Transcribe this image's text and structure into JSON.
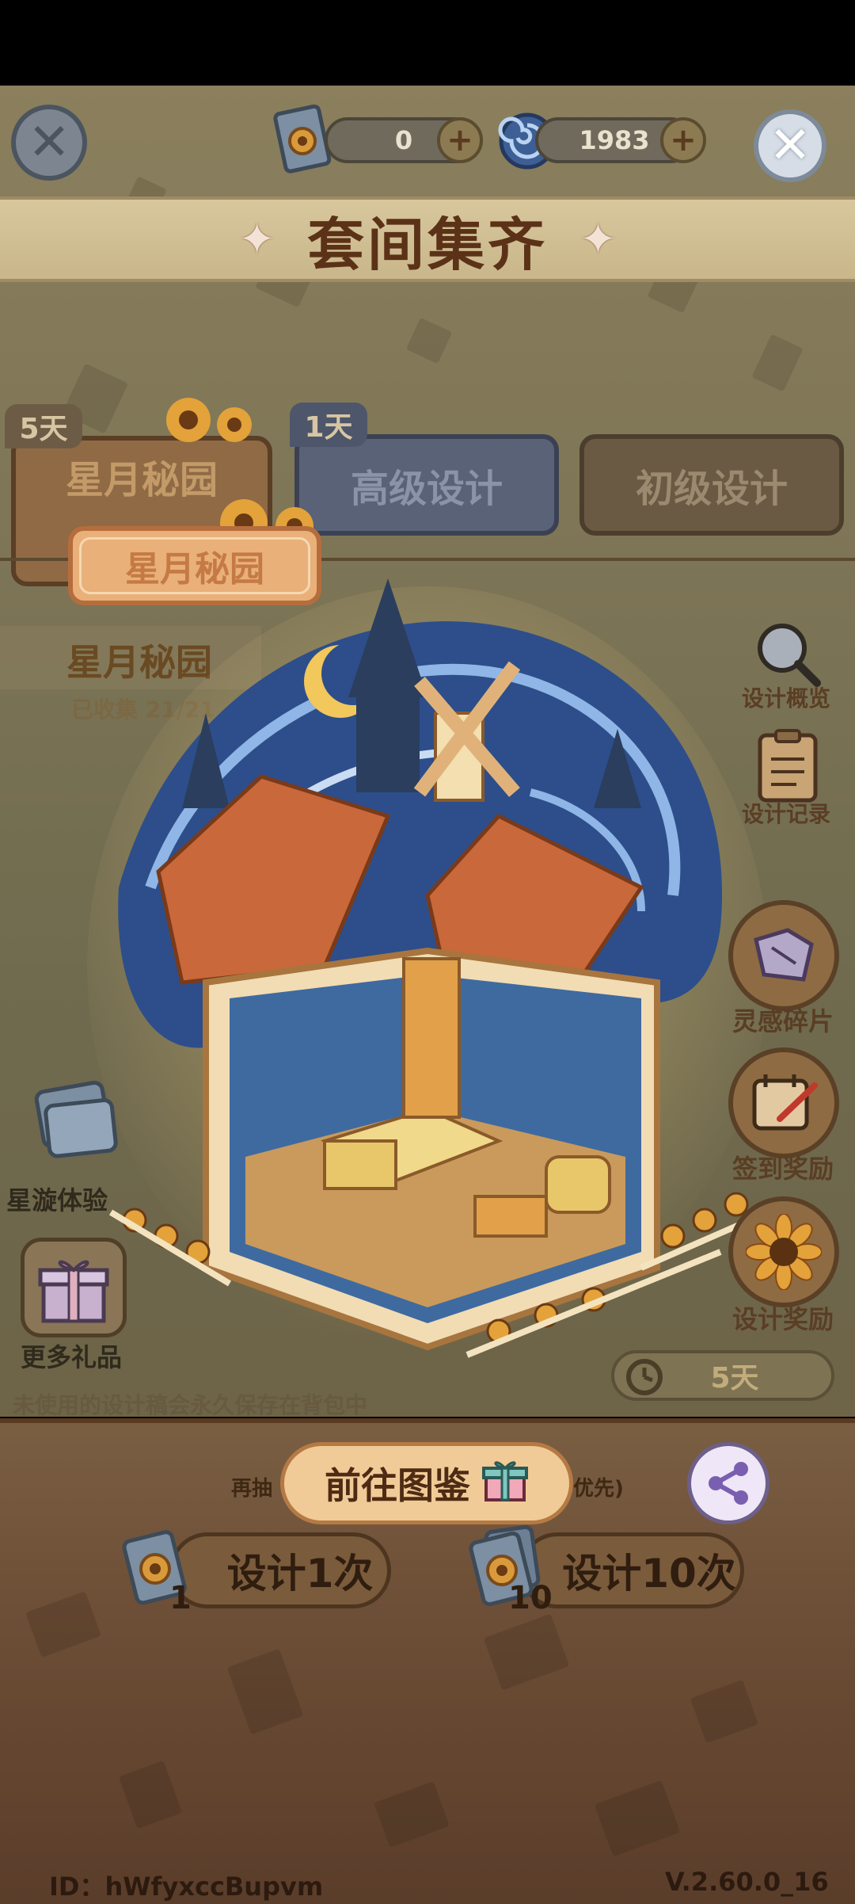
{
  "top_bar": {
    "ticket_count": "0",
    "swirl_currency": "1983"
  },
  "banner": {
    "title": "套间集齐"
  },
  "tabs": [
    {
      "label": "星月秘园",
      "days": "5天"
    },
    {
      "label": "高级设计",
      "days": "1天"
    },
    {
      "label": "初级设计",
      "days": ""
    }
  ],
  "theme": {
    "plaque_label": "星月秘园",
    "title": "星月秘园",
    "collected": "已收集 21/21"
  },
  "side_menu": {
    "design_overview": "设计概览",
    "design_record": "设计记录",
    "inspiration_fragments": "灵感碎片",
    "signin_reward": "签到奖励",
    "design_reward": "设计奖励"
  },
  "left_menu": {
    "star_swirl_trial": "星漩体验",
    "more_gifts": "更多礼品"
  },
  "hint": "未使用的设计稿会永久保存在背包中",
  "timer": "5天",
  "bottom": {
    "goto_gallery": "前往图鉴",
    "redraw_left": "再抽",
    "redraw_right": "优先)",
    "draw_once": "设计1次",
    "draw_once_cost": "1",
    "draw_ten": "设计10次",
    "draw_ten_cost": "10"
  },
  "footer": {
    "id": "ID：hWfyxccBupvm",
    "version": "V.2.60.0_16"
  },
  "colors": {
    "banner": "#d8c79d",
    "banner_text": "#5b3217",
    "goto_button": "#f1cb97"
  }
}
